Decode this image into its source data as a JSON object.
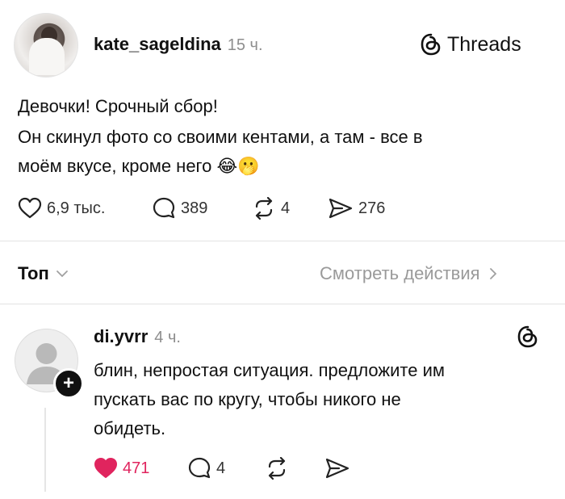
{
  "post": {
    "username": "kate_sageldina",
    "time": "15 ч.",
    "lines": [
      "Девочки! Срочный сбор!",
      "Он скинул фото со своими кентами, а там - все в",
      "моём вкусе, кроме него 😂🫢"
    ],
    "likes": "6,9 тыс.",
    "comments": "389",
    "reposts": "4",
    "shares": "276"
  },
  "brand": {
    "name": "Threads"
  },
  "sort_bar": {
    "tab_label": "Топ",
    "view_activity": "Смотреть действия"
  },
  "reply": {
    "username": "di.yvrr",
    "time": "4 ч.",
    "lines": [
      "блин, непростая ситуация. предложите им",
      "пускать вас по кругу, чтобы никого не",
      "обидеть."
    ],
    "likes": "471",
    "comments": "4",
    "plus_badge": "+"
  },
  "colors": {
    "like_active": "#e0245e",
    "muted": "#8e8e8e"
  },
  "icons": [
    "heart-icon",
    "comment-icon",
    "repost-icon",
    "share-icon",
    "threads-logo-icon",
    "chevron-down-icon",
    "chevron-right-icon"
  ]
}
